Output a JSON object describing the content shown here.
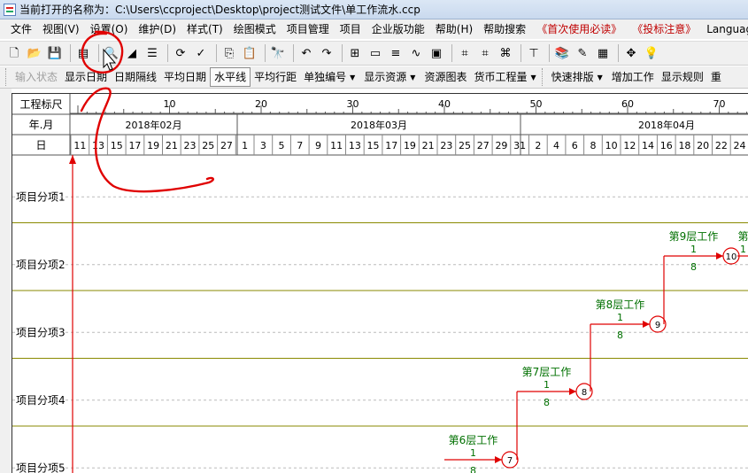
{
  "window": {
    "title": "当前打开的名称为：C:\\Users\\ccproject\\Desktop\\project测试文件\\单工作流水.ccp"
  },
  "menu": [
    {
      "label": "文件",
      "red": false
    },
    {
      "label": "视图(V)",
      "red": false
    },
    {
      "label": "设置(O)",
      "red": false
    },
    {
      "label": "维护(D)",
      "red": false
    },
    {
      "label": "样式(T)",
      "red": false
    },
    {
      "label": "绘图模式",
      "red": false
    },
    {
      "label": "项目管理",
      "red": false
    },
    {
      "label": "项目",
      "red": false
    },
    {
      "label": "企业版功能",
      "red": false
    },
    {
      "label": "帮助(H)",
      "red": false
    },
    {
      "label": "帮助搜索",
      "red": false
    },
    {
      "label": "《首次使用必读》",
      "red": true
    },
    {
      "label": "《投标注意》",
      "red": true
    },
    {
      "label": "Language",
      "red": false
    }
  ],
  "toolbar": {
    "icons": [
      "new-file-icon",
      "open-folder-icon",
      "save-icon",
      "print-icon",
      "print-preview-icon",
      "format-icon",
      "outline-icon",
      "refresh-icon",
      "check-icon",
      "copy-icon",
      "paste-icon",
      "find-icon",
      "undo-icon",
      "redo-icon",
      "network-icon",
      "bar-icon",
      "stack-icon",
      "line-icon",
      "resource-icon",
      "grid1-icon",
      "grid2-icon",
      "grid3-icon",
      "align-icon",
      "book-icon",
      "edit-icon",
      "layout-icon",
      "move-icon",
      "bulb-icon"
    ],
    "glyphs": [
      "🗋",
      "📂",
      "💾",
      "▤",
      "🔍",
      "◢",
      "☰",
      "⟳",
      "✓",
      "⎘",
      "📋",
      "🔭",
      "↶",
      "↷",
      "⊞",
      "▭",
      "≡",
      "∿",
      "▣",
      "⌗",
      "⌗",
      "⌘",
      "⊤",
      "📚",
      "✎",
      "▦",
      "✥",
      "💡"
    ]
  },
  "toolbar2": {
    "items": [
      {
        "label": "输入状态",
        "state": "disabled",
        "dropdown": false
      },
      {
        "label": "显示日期",
        "state": "normal",
        "dropdown": false
      },
      {
        "label": "日期隔线",
        "state": "normal",
        "dropdown": false
      },
      {
        "label": "平均日期",
        "state": "normal",
        "dropdown": false
      },
      {
        "label": "水平线",
        "state": "active",
        "dropdown": false
      },
      {
        "label": "平均行距",
        "state": "normal",
        "dropdown": false
      },
      {
        "label": "单独编号",
        "state": "normal",
        "dropdown": true
      },
      {
        "label": "显示资源",
        "state": "normal",
        "dropdown": true
      },
      {
        "label": "资源图表",
        "state": "normal",
        "dropdown": false
      },
      {
        "label": "货币工程量",
        "state": "normal",
        "dropdown": true
      },
      {
        "label": "快速排版",
        "state": "normal",
        "dropdown": true
      },
      {
        "label": "增加工作",
        "state": "normal",
        "dropdown": false
      },
      {
        "label": "显示规则",
        "state": "normal",
        "dropdown": false
      },
      {
        "label": "重",
        "state": "normal",
        "dropdown": false
      }
    ]
  },
  "timescale": {
    "row_labels": {
      "scale": "工程标尺",
      "month": "年.月",
      "day": "日"
    },
    "scale_ticks": [
      "10",
      "20",
      "30",
      "40",
      "50",
      "60",
      "70"
    ],
    "months": [
      "2018年02月",
      "2018年03月",
      "2018年04月"
    ],
    "days": [
      "11",
      "13",
      "15",
      "17",
      "19",
      "21",
      "23",
      "25",
      "27",
      "1",
      "3",
      "5",
      "7",
      "9",
      "11",
      "13",
      "15",
      "17",
      "19",
      "21",
      "23",
      "25",
      "27",
      "29",
      "31",
      "2",
      "4",
      "6",
      "8",
      "10",
      "12",
      "14",
      "16",
      "18",
      "20",
      "22",
      "24"
    ]
  },
  "rows": [
    "项目分项1",
    "项目分项2",
    "项目分项3",
    "项目分项4",
    "项目分项5"
  ],
  "tasks": [
    {
      "name": "第6层工作",
      "top_text": "1",
      "bottom_text": "8",
      "end_node": "7"
    },
    {
      "name": "第7层工作",
      "top_text": "1",
      "bottom_text": "8",
      "end_node": "8"
    },
    {
      "name": "第8层工作",
      "top_text": "1",
      "bottom_text": "8",
      "end_node": "9"
    },
    {
      "name": "第9层工作",
      "top_text": "1",
      "bottom_text": "8",
      "end_node": "10"
    },
    {
      "name": "第",
      "top_text": "1",
      "bottom_text": "",
      "end_node": ""
    }
  ],
  "colors": {
    "task_line": "#e00000",
    "task_text": "#007000",
    "row_divider": "#8a8a00",
    "annotation": "#e00000"
  }
}
